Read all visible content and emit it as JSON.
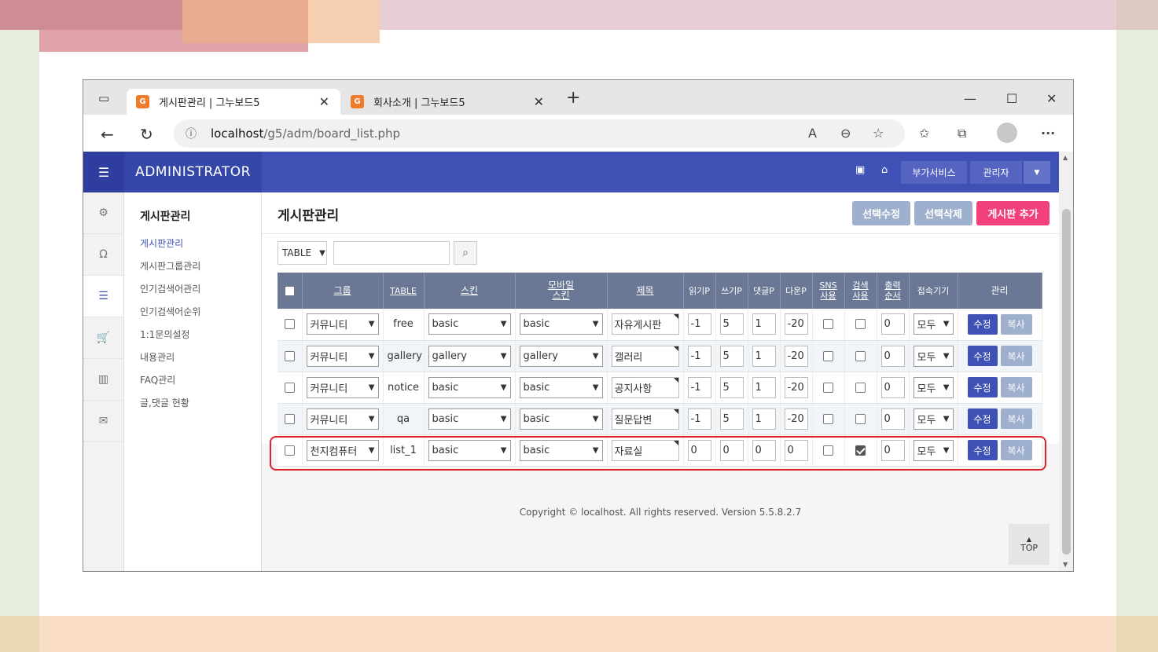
{
  "browser": {
    "tabs": [
      {
        "title": "게시판관리 | 그누보드5",
        "active": true
      },
      {
        "title": "회사소개 | 그누보드5",
        "active": false
      }
    ],
    "new_tab": "+",
    "url_host": "localhost",
    "url_path": "/g5/adm/board_list.php",
    "icons": [
      "back-icon",
      "refresh-icon",
      "info-icon",
      "read-aloud-icon",
      "zoom-icon",
      "favorite-add-icon",
      "favorites-icon",
      "collections-icon",
      "profile-icon",
      "more-icon"
    ]
  },
  "admin": {
    "logo": "ADMINISTRATOR",
    "addon_service": "부가서비스",
    "admin_user": "관리자",
    "submenu_title": "게시판관리",
    "submenu_items": [
      "게시판관리",
      "게시판그룹관리",
      "인기검색어관리",
      "인기검색어순위",
      "1:1문의설정",
      "내용관리",
      "FAQ관리",
      "글,댓글 현황"
    ],
    "page_title": "게시판관리",
    "btn_select_edit": "선택수정",
    "btn_select_delete": "선택삭제",
    "btn_add_board": "게시판 추가",
    "search_select": "TABLE",
    "colors": {
      "primary": "#3f51b5",
      "header": "#6a7895",
      "pink": "#f2417a",
      "grey_btn": "#9eb0cd",
      "highlight": "#e0202c"
    }
  },
  "table": {
    "headers": {
      "group": "그룹",
      "table": "TABLE",
      "skin": "스킨",
      "mobile1": "모바일",
      "mobile2": "스킨",
      "subject": "제목",
      "read": "읽기P",
      "write": "쓰기P",
      "comment": "댓글P",
      "download": "다운P",
      "sns1": "SNS",
      "sns2": "사용",
      "search1": "검색",
      "search2": "사용",
      "order1": "출력",
      "order2": "순서",
      "device": "접속기기",
      "manage": "관리"
    },
    "rows": [
      {
        "group": "커뮤니티",
        "table": "free",
        "skin": "basic",
        "mskin": "basic",
        "subject": "자유게시판",
        "read": "-1",
        "write": "5",
        "comment": "1",
        "download": "-20",
        "sns": false,
        "search": false,
        "order": "0",
        "device": "모두",
        "edit": "수정",
        "copy": "복사"
      },
      {
        "group": "커뮤니티",
        "table": "gallery",
        "skin": "gallery",
        "mskin": "gallery",
        "subject": "갤러리",
        "read": "-1",
        "write": "5",
        "comment": "1",
        "download": "-20",
        "sns": false,
        "search": false,
        "order": "0",
        "device": "모두",
        "edit": "수정",
        "copy": "복사"
      },
      {
        "group": "커뮤니티",
        "table": "notice",
        "skin": "basic",
        "mskin": "basic",
        "subject": "공지사항",
        "read": "-1",
        "write": "5",
        "comment": "1",
        "download": "-20",
        "sns": false,
        "search": false,
        "order": "0",
        "device": "모두",
        "edit": "수정",
        "copy": "복사"
      },
      {
        "group": "커뮤니티",
        "table": "qa",
        "skin": "basic",
        "mskin": "basic",
        "subject": "질문답변",
        "read": "-1",
        "write": "5",
        "comment": "1",
        "download": "-20",
        "sns": false,
        "search": false,
        "order": "0",
        "device": "모두",
        "edit": "수정",
        "copy": "복사"
      },
      {
        "group": "천지컴퓨터",
        "table": "list_1",
        "skin": "basic",
        "mskin": "basic",
        "subject": "자료실",
        "read": "0",
        "write": "0",
        "comment": "0",
        "download": "0",
        "sns": false,
        "search": true,
        "order": "0",
        "device": "모두",
        "edit": "수정",
        "copy": "복사"
      }
    ]
  },
  "footer": "Copyright © localhost. All rights reserved. Version 5.5.8.2.7",
  "top_button": "TOP"
}
